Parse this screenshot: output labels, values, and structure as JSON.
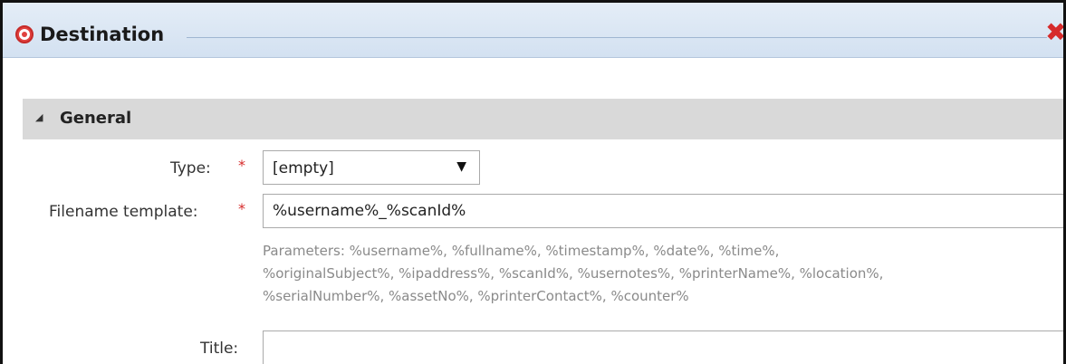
{
  "dialog": {
    "title": "Destination",
    "close_symbol": "✖",
    "icon": "target-icon"
  },
  "section": {
    "title": "General",
    "toggle_symbol": "◢"
  },
  "form": {
    "type": {
      "label": "Type:",
      "required_mark": "*",
      "value": "[empty]",
      "arrow": "▼"
    },
    "filename_template": {
      "label": "Filename template:",
      "required_mark": "*",
      "value": "%username%_%scanId%",
      "help_lines": [
        "Parameters: %username%, %fullname%, %timestamp%, %date%, %time%,",
        "%originalSubject%, %ipaddress%, %scanId%, %usernotes%, %printerName%, %location%,",
        "%serialNumber%, %assetNo%, %printerContact%, %counter%"
      ]
    },
    "title": {
      "label": "Title:",
      "value": ""
    }
  },
  "colors": {
    "titlebar": "#d3e1f1",
    "section_header": "#d9d9d9",
    "required": "#d62b2b",
    "close": "#d62b2b"
  }
}
